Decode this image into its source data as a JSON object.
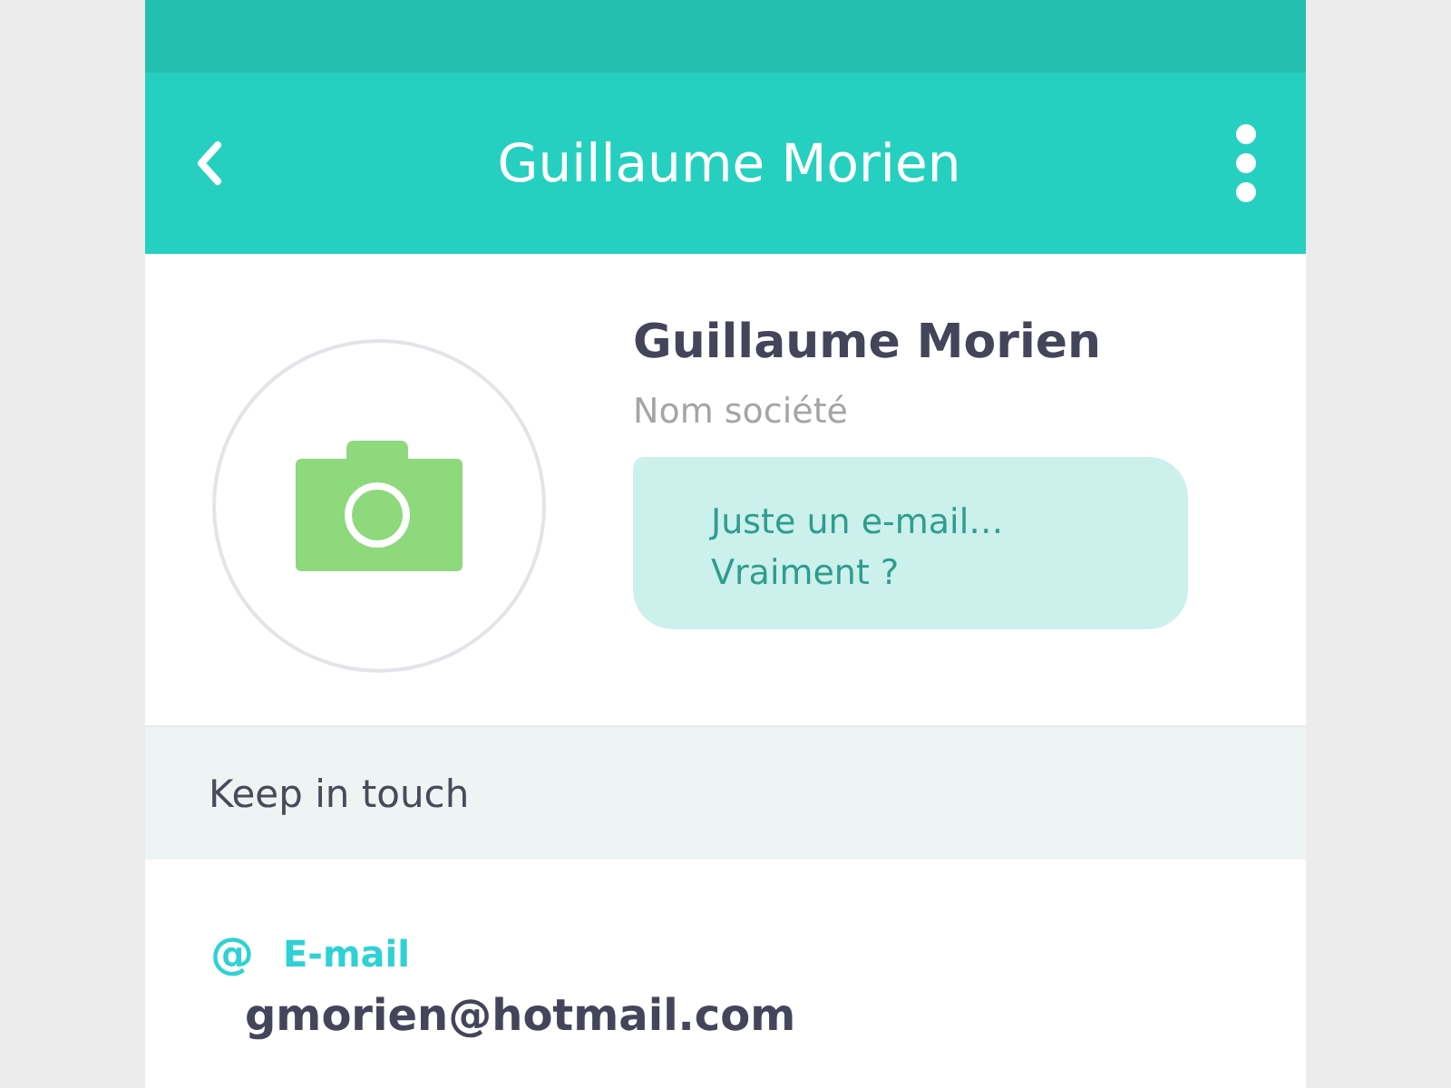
{
  "app_bar": {
    "title": "Guillaume Morien"
  },
  "profile": {
    "name": "Guillaume Morien",
    "company": "Nom société",
    "note": "Juste un e-mail…\nVraiment ?"
  },
  "section": {
    "title": "Keep in touch"
  },
  "contacts": [
    {
      "symbol": "@",
      "label": "E-mail",
      "value": "gmorien@hotmail.com"
    }
  ]
}
